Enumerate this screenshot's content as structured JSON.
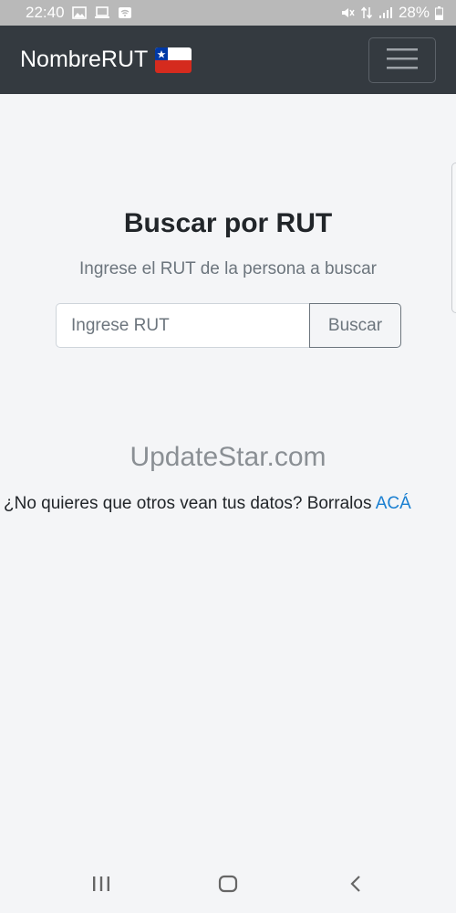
{
  "status_bar": {
    "time": "22:40",
    "battery": "28%"
  },
  "navbar": {
    "brand": "NombreRUT",
    "flag_colors": {
      "blue": "#0039a6",
      "white": "#ffffff",
      "red": "#d52b1e"
    },
    "menu_icon": "hamburger-icon"
  },
  "main": {
    "title": "Buscar por RUT",
    "subtitle": "Ingrese el RUT de la persona a buscar",
    "search_placeholder": "Ingrese RUT",
    "search_value": "",
    "search_button": "Buscar"
  },
  "watermark": "UpdateStar.com",
  "notice": {
    "text": "¿No quieres que otros vean tus datos? Borralos ",
    "link": "ACÁ"
  },
  "colors": {
    "navbar_bg": "#343a40",
    "link": "#1a7fd1",
    "page_bg": "#f4f5f7"
  },
  "android_nav": [
    "recents-icon",
    "home-icon",
    "back-icon"
  ]
}
